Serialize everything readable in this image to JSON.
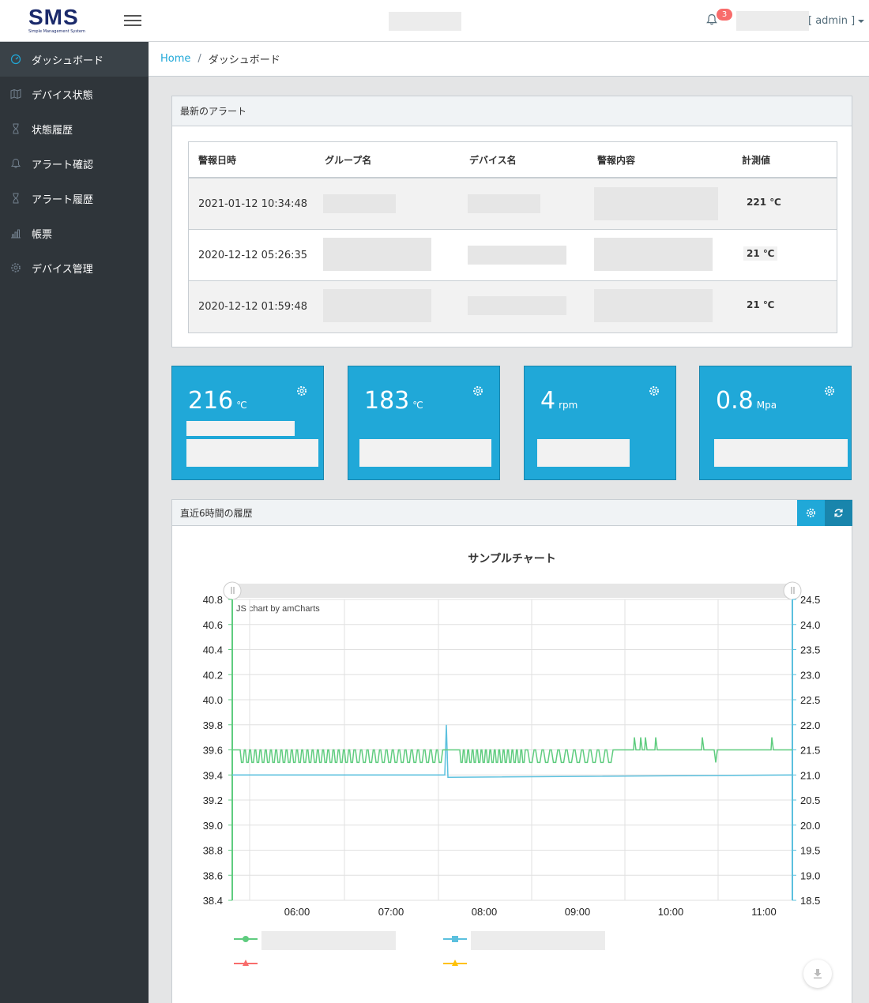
{
  "header": {
    "logo_text": "SMS",
    "logo_sub": "Simple Management System",
    "notification_count": "3",
    "user_label": "[ admin ]"
  },
  "sidebar": {
    "items": [
      {
        "label": "ダッシュボード",
        "icon": "speedometer-icon",
        "active": true
      },
      {
        "label": "デバイス状態",
        "icon": "map-icon",
        "active": false
      },
      {
        "label": "状態履歴",
        "icon": "hourglass-icon",
        "active": false
      },
      {
        "label": "アラート確認",
        "icon": "bell-icon",
        "active": false
      },
      {
        "label": "アラート履歴",
        "icon": "hourglass-icon",
        "active": false
      },
      {
        "label": "帳票",
        "icon": "bar-chart-icon",
        "active": false
      },
      {
        "label": "デバイス管理",
        "icon": "gear-icon",
        "active": false
      }
    ]
  },
  "breadcrumb": {
    "home": "Home",
    "separator": "/",
    "current": "ダッシュボード"
  },
  "alerts": {
    "title": "最新のアラート",
    "columns": [
      "警報日時",
      "グループ名",
      "デバイス名",
      "警報内容",
      "計測値"
    ],
    "rows": [
      {
        "datetime": "2021-01-12 10:34:48",
        "value": "221 ℃"
      },
      {
        "datetime": "2020-12-12 05:26:35",
        "value": "21 ℃"
      },
      {
        "datetime": "2020-12-12 01:59:48",
        "value": "21 ℃"
      }
    ]
  },
  "tiles": [
    {
      "value": "216",
      "unit": "℃"
    },
    {
      "value": "183",
      "unit": "℃"
    },
    {
      "value": "4",
      "unit": "rpm"
    },
    {
      "value": "0.8",
      "unit": "Mpa"
    }
  ],
  "history": {
    "title": "直近6時間の履歴",
    "credit": "JS chart by amCharts"
  },
  "colors": {
    "primary": "#20a8d8",
    "sidebar": "#2f353a",
    "green_series": "#5fcc7f",
    "blue_series": "#5bc0de",
    "red_series": "#f86c6b",
    "yellow_series": "#ffc107"
  },
  "chart_data": {
    "type": "line",
    "title": "サンプルチャート",
    "x_ticks": [
      "06:00",
      "07:00",
      "08:00",
      "09:00",
      "10:00",
      "11:00"
    ],
    "y_left": {
      "min": 38.4,
      "max": 40.8,
      "ticks": [
        "40.8",
        "40.6",
        "40.4",
        "40.2",
        "40.0",
        "39.8",
        "39.6",
        "39.4",
        "39.2",
        "39.0",
        "38.8",
        "38.6",
        "38.4"
      ]
    },
    "y_right": {
      "min": 18.5,
      "max": 24.5,
      "ticks": [
        "24.5",
        "24.0",
        "23.5",
        "23.0",
        "22.5",
        "22.0",
        "21.5",
        "21.0",
        "20.5",
        "20.0",
        "19.5",
        "19.0",
        "18.5"
      ]
    },
    "series": [
      {
        "axis": "left",
        "color": "#5fcc7f",
        "marker": "circle",
        "baseline": 39.6,
        "dip": 39.5,
        "description": "oscillates between 39.5 and 39.6 with spikes to 39.7"
      },
      {
        "axis": "left",
        "color": "#5bc0de",
        "marker": "square",
        "baseline": 39.4,
        "spike": 39.8
      },
      {
        "axis": "left",
        "color": "#f86c6b",
        "marker": "triangle"
      },
      {
        "axis": "left",
        "color": "#ffc107",
        "marker": "triangle"
      }
    ]
  }
}
